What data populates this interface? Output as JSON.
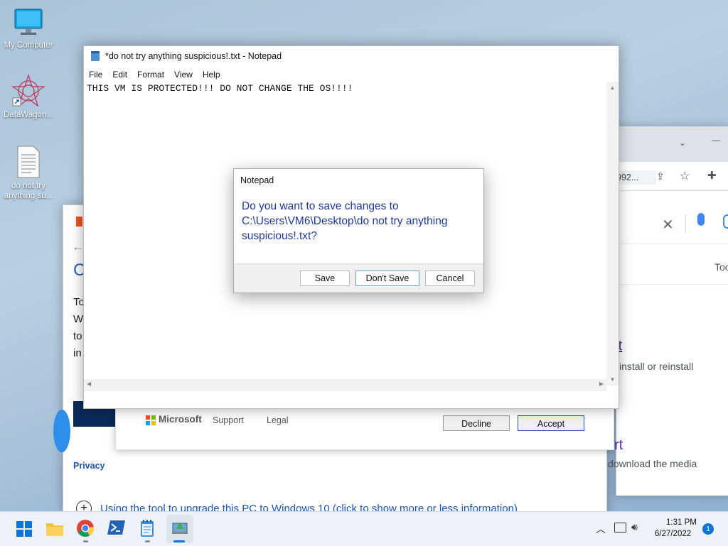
{
  "desktop": {
    "icons": [
      {
        "label": "My Computer"
      },
      {
        "label": "DataWagon..."
      },
      {
        "label": "do not try anything su..."
      }
    ]
  },
  "chrome": {
    "url_fragment": "992...",
    "tools_label": "Too",
    "result1_link": "oft",
    "result1_text": "install or reinstall",
    "result2_link": "ort",
    "result2_text": "download the media"
  },
  "installer": {
    "heading_fragment": "C",
    "lines": [
      "To",
      "W",
      "to",
      "in"
    ],
    "privacy_link": "Privacy",
    "accordion_text": "Using the tool to upgrade this PC to Windows 10 (click to show more or less information)",
    "terms": {
      "logo": "Microsoft",
      "support": "Support",
      "legal": "Legal",
      "decline": "Decline",
      "accept": "Accept"
    }
  },
  "notepad": {
    "title": "*do not try anything suspicious!.txt - Notepad",
    "menu": [
      "File",
      "Edit",
      "Format",
      "View",
      "Help"
    ],
    "content": "THIS VM IS PROTECTED!!! DO NOT CHANGE THE OS!!!!"
  },
  "dialog": {
    "title": "Notepad",
    "message": "Do you want to save changes to C:\\Users\\VM6\\Desktop\\do not try anything suspicious!.txt?",
    "save": "Save",
    "dont_save": "Don't Save",
    "cancel": "Cancel"
  },
  "taskbar": {
    "time": "1:31 PM",
    "date": "6/27/2022",
    "notification_count": "1"
  }
}
